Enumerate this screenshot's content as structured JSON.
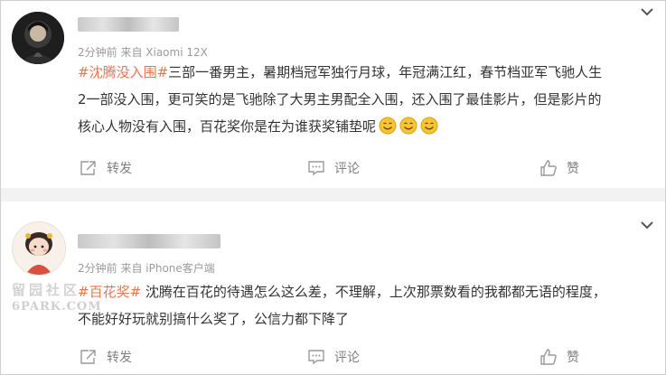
{
  "posts": [
    {
      "meta": "2分钟前  来自 Xiaomi 12X",
      "hashtag": "#沈腾没入围#",
      "line1_rest": "三部一番男主，暑期档冠军独行月球，年冠满江红，春节档亚军飞驰人生",
      "line2": "2一部没入围，更可笑的是飞驰除了大男主男配全入围，还入围了最佳影片，但是影片的",
      "line3": "核心人物没有入围，百花奖你是在为谁获奖铺垫呢",
      "emoji": "smile-emoji",
      "emoji_count": 3
    },
    {
      "meta": "2分钟前  来自 iPhone客户端",
      "hashtag": "#百花奖#",
      "line1_rest": " 沈腾在百花的待遇怎么这么差，不理解，上次那票数看的我都都无语的程度，",
      "line2": "不能好好玩就别搞什么奖了，公信力都下降了"
    }
  ],
  "actions": {
    "share": "转发",
    "comment": "评论",
    "like": "赞"
  },
  "watermark": {
    "line1": "留园社区",
    "line2": "6PARK.COM"
  },
  "colors": {
    "hashtag": "#eb7350",
    "meta": "#9a9a9a",
    "action": "#808080",
    "divider": "#f2f2f2"
  }
}
